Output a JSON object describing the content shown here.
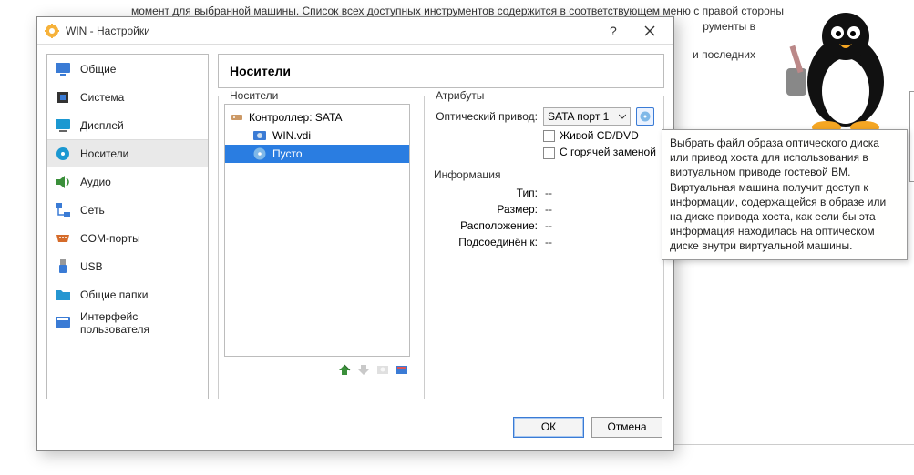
{
  "bg": {
    "line1": "момент для выбранной машины. Список всех доступных инструментов содержится в соответствующем меню с правой стороны",
    "line2": "рументы в",
    "line3": "и последних"
  },
  "dialog": {
    "title": "WIN - Настройки",
    "sidebar": [
      {
        "icon": "general",
        "label": "Общие"
      },
      {
        "icon": "system",
        "label": "Система"
      },
      {
        "icon": "display",
        "label": "Дисплей"
      },
      {
        "icon": "storage",
        "label": "Носители",
        "selected": true
      },
      {
        "icon": "audio",
        "label": "Аудио"
      },
      {
        "icon": "network",
        "label": "Сеть"
      },
      {
        "icon": "serial",
        "label": "COM-порты"
      },
      {
        "icon": "usb",
        "label": "USB"
      },
      {
        "icon": "shared",
        "label": "Общие папки"
      },
      {
        "icon": "ui",
        "label": "Интерфейс пользователя"
      }
    ],
    "page_title": "Носители",
    "tree": {
      "legend": "Носители",
      "controller": "Контроллер: SATA",
      "items": [
        {
          "icon": "hdd",
          "label": "WIN.vdi"
        },
        {
          "icon": "cd",
          "label": "Пусто",
          "selected": true
        }
      ]
    },
    "attrs": {
      "legend": "Атрибуты",
      "drive_label": "Оптический привод:",
      "drive_value": "SATA порт 1",
      "live_cd": "Живой CD/DVD",
      "hot_swap": "С горячей заменой"
    },
    "info": {
      "legend": "Информация",
      "rows": [
        {
          "k": "Тип:",
          "v": "--"
        },
        {
          "k": "Размер:",
          "v": "--"
        },
        {
          "k": "Расположение:",
          "v": "--"
        },
        {
          "k": "Подсоединён к:",
          "v": "--"
        }
      ]
    },
    "buttons": {
      "ok": "ОК",
      "cancel": "Отмена"
    }
  },
  "tooltip": "Выбрать файл образа оптического диска или привод хоста для использования в виртуальном приводе гостевой ВМ. Виртуальная машина получит доступ к информации, содержащейся в образе или на диске привода хоста, как если бы эта информация находилась на оптическом диске внутри виртуальной машины."
}
